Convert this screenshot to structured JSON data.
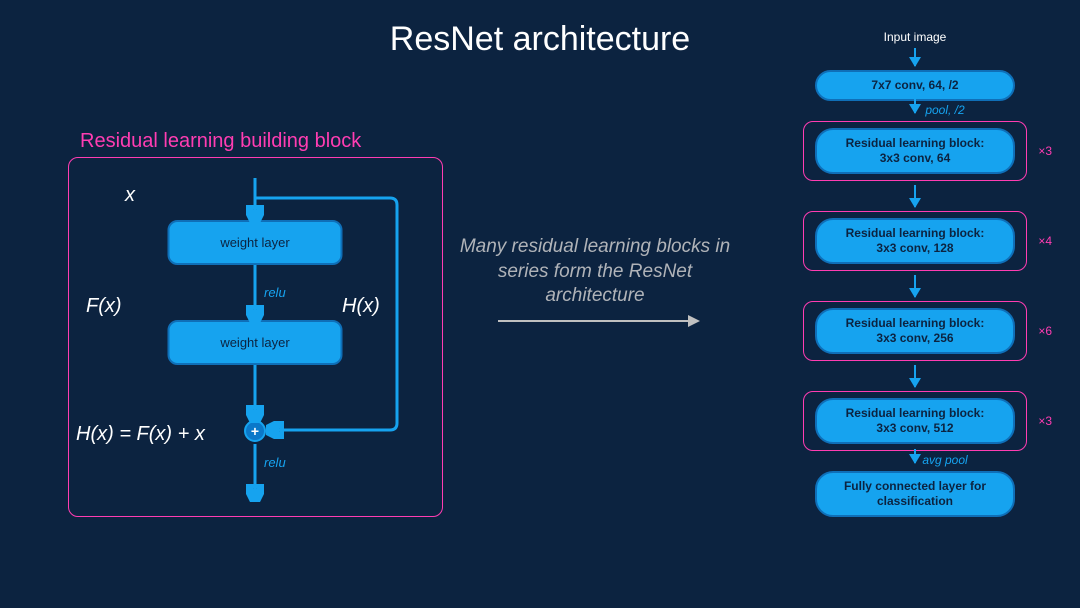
{
  "title": "ResNet architecture",
  "left": {
    "heading": "Residual learning building block",
    "x": "x",
    "weight_layer": "weight layer",
    "fx": "F(x)",
    "hx": "H(x)",
    "equation": "H(x) = F(x) + x",
    "relu": "relu",
    "plus": "+"
  },
  "middle": {
    "text": "Many residual learning blocks in series form the ResNet architecture"
  },
  "right": {
    "input": "Input image",
    "conv1": "7x7 conv, 64, /2",
    "pool": "pool, /2",
    "avgpool": "avg pool",
    "fc": "Fully connected layer for classification",
    "blocks": [
      {
        "line1": "Residual learning block:",
        "line2": "3x3 conv, 64",
        "repeat": "×3"
      },
      {
        "line1": "Residual learning block:",
        "line2": "3x3 conv, 128",
        "repeat": "×4"
      },
      {
        "line1": "Residual learning block:",
        "line2": "3x3 conv, 256",
        "repeat": "×6"
      },
      {
        "line1": "Residual learning block:",
        "line2": "3x3 conv, 512",
        "repeat": "×3"
      }
    ]
  }
}
